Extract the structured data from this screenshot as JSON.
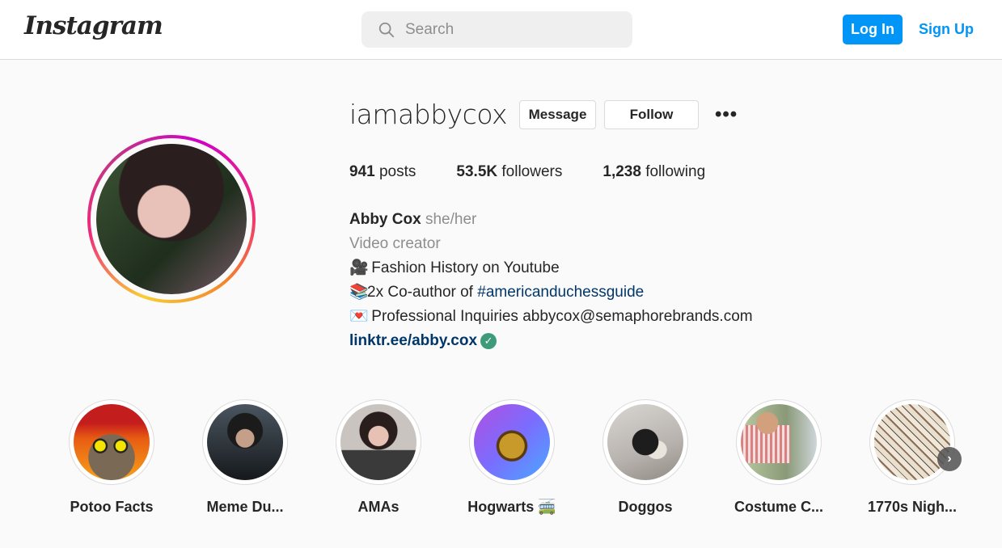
{
  "header": {
    "logo": "Instagram",
    "search_placeholder": "Search",
    "login_label": "Log In",
    "signup_label": "Sign Up"
  },
  "profile": {
    "username": "iamabbycox",
    "message_label": "Message",
    "follow_label": "Follow",
    "more_label": "•••",
    "stats": {
      "posts_count": "941",
      "posts_label": "posts",
      "followers_count": "53.5K",
      "followers_label": "followers",
      "following_count": "1,238",
      "following_label": "following"
    },
    "bio": {
      "name": "Abby Cox",
      "pronouns": "she/her",
      "category": "Video creator",
      "line1_emoji": "🎥",
      "line1": "Fashion History on Youtube",
      "line2_emoji": "📚",
      "line2_prefix": "2x Co-author of ",
      "line2_tag": "#americanduchessguide",
      "line3_emoji": "💌",
      "line3": "Professional Inquiries abbycox@semaphorebrands.com",
      "link": "linktr.ee/abby.cox",
      "verified_glyph": "✓"
    }
  },
  "highlights": [
    {
      "label": "Potoo Facts"
    },
    {
      "label": "Meme Du..."
    },
    {
      "label": "AMAs"
    },
    {
      "label": "Hogwarts 🚎"
    },
    {
      "label": "Doggos"
    },
    {
      "label": "Costume C..."
    },
    {
      "label": "1770s Nigh..."
    }
  ],
  "next_arrow": "›",
  "colors": {
    "primary_button": "#0095f6",
    "link": "#00376b",
    "secondary_text": "#8e8e8e"
  }
}
